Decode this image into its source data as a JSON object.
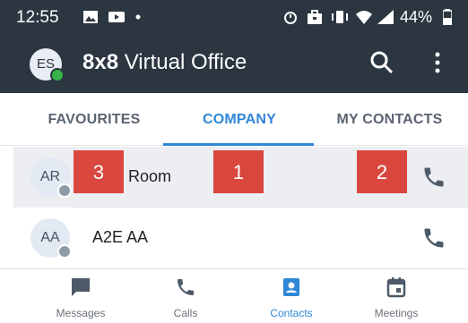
{
  "status_bar": {
    "time": "12:55",
    "battery": "44%"
  },
  "app_bar": {
    "user_initials": "ES",
    "brand": "8x8",
    "product": "Virtual Office"
  },
  "tabs": [
    {
      "label": "FAVOURITES",
      "active": false
    },
    {
      "label": "COMPANY",
      "active": true
    },
    {
      "label": "MY CONTACTS",
      "active": false
    }
  ],
  "contacts": [
    {
      "initials": "AR",
      "name": "Room"
    },
    {
      "initials": "AA",
      "name": "A2E AA"
    }
  ],
  "annotations": [
    "3",
    "1",
    "2"
  ],
  "bottom_nav": [
    {
      "label": "Messages",
      "icon": "message-icon"
    },
    {
      "label": "Calls",
      "icon": "phone-icon"
    },
    {
      "label": "Contacts",
      "icon": "contacts-icon",
      "active": true
    },
    {
      "label": "Meetings",
      "icon": "calendar-icon"
    }
  ],
  "colors": {
    "appbar": "#2b3641",
    "accent": "#2f87d8",
    "presence_online": "#37b34a",
    "annotation": "#d9473f"
  }
}
